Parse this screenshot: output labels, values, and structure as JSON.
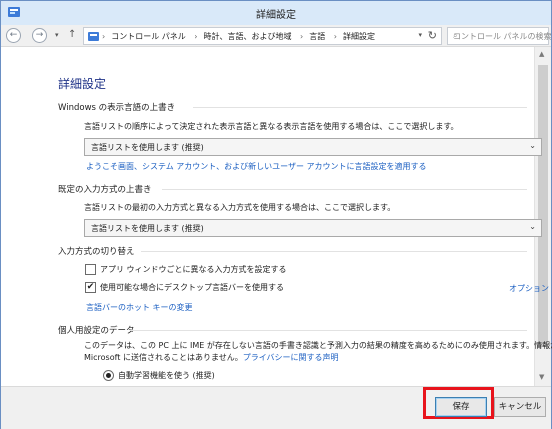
{
  "window": {
    "title": "詳細設定"
  },
  "nav": {
    "back_glyph": "←",
    "forward_glyph": "→",
    "dropdown_glyph": "▾",
    "up_glyph": "↑",
    "breadcrumbs": [
      "コントロール パネル",
      "時計、言語、および地域",
      "言語",
      "詳細設定"
    ],
    "breadcrumb_sep": "›",
    "refresh_glyph": "↻",
    "search_placeholder": "コントロール パネルの検索",
    "search_glyph": "⌕"
  },
  "main": {
    "heading": "詳細設定",
    "display_language": {
      "title": "Windows の表示言語の上書き",
      "description": "言語リストの順序によって決定された表示言語と異なる表示言語を使用する場合は、ここで選択します。",
      "combo_value": "言語リストを使用します (推奨)",
      "link": "ようこそ画面、システム アカウント、および新しいユーザー アカウントに言語設定を適用する"
    },
    "input_method": {
      "title": "既定の入力方式の上書き",
      "description": "言語リストの最初の入力方式と異なる入力方式を使用する場合は、ここで選択します。",
      "combo_value": "言語リストを使用します (推奨)"
    },
    "switching": {
      "title": "入力方式の切り替え",
      "per_app_label": "アプリ ウィンドウごとに異なる入力方式を設定する",
      "per_app_checked": false,
      "desktop_bar_label": "使用可能な場合にデスクトップ言語バーを使用する",
      "desktop_bar_checked": true,
      "options_link": "オプション",
      "hotkey_link": "言語バーのホット キーの変更"
    },
    "personalization": {
      "title": "個人用設定のデータ",
      "description_line1": "このデータは、この PC 上に IME が存在しない言語の手書き認識と予測入力の結果の精度を高めるためにのみ使用されます。情報が",
      "description_line2": "Microsoft に送信されることはありません。",
      "privacy_link": "プライバシーに関する声明",
      "radio_label": "自動学習機能を使う (推奨)",
      "radio_selected": true
    }
  },
  "footer": {
    "save_label": "保存",
    "cancel_label": "キャンセル"
  },
  "colors": {
    "highlight": "#e8141c",
    "link": "#1b5fc2",
    "heading": "#1e3287"
  }
}
